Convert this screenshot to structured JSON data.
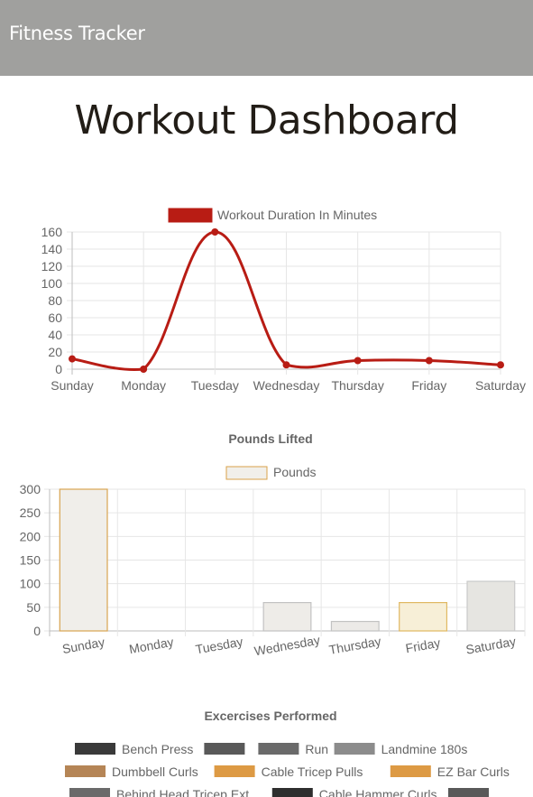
{
  "app": {
    "title": "Fitness Tracker"
  },
  "page": {
    "title": "Workout Dashboard"
  },
  "colors": {
    "header_bg": "#a0a09e",
    "duration_line": "#b81c14",
    "pounds_border": "#d9a24a"
  },
  "charts": {
    "duration": {
      "legend": "Workout Duration In Minutes",
      "y_ticks": [
        "0",
        "20",
        "40",
        "60",
        "80",
        "100",
        "120",
        "140",
        "160"
      ],
      "x_ticks": [
        "Sunday",
        "Monday",
        "Tuesday",
        "Wednesday",
        "Thursday",
        "Friday",
        "Saturday"
      ]
    },
    "pounds": {
      "title": "Pounds Lifted",
      "legend": "Pounds",
      "y_ticks": [
        "0",
        "50",
        "100",
        "150",
        "200",
        "250",
        "300"
      ],
      "x_ticks": [
        "Sunday",
        "Monday",
        "Tuesday",
        "Wednesday",
        "Thursday",
        "Friday",
        "Saturday"
      ]
    },
    "exercises": {
      "title": "Excercises Performed",
      "legend": [
        {
          "label": "Bench Press",
          "color": "#3a3a3a"
        },
        {
          "label": "",
          "color": "#595959"
        },
        {
          "label": "Run",
          "color": "#6a6a6a"
        },
        {
          "label": "Landmine 180s",
          "color": "#8c8c8c"
        },
        {
          "label": "Dumbbell Curls",
          "color": "#b58556"
        },
        {
          "label": "Cable Tricep Pulls",
          "color": "#dd9a44"
        },
        {
          "label": "EZ Bar Curls",
          "color": "#dd9a44"
        },
        {
          "label": "Behind Head Tricep Ext",
          "color": "#6a6a6a"
        },
        {
          "label": "Cable Hammer Curls",
          "color": "#2e2e2e"
        },
        {
          "label": "",
          "color": "#595959"
        }
      ]
    }
  },
  "chart_data": [
    {
      "type": "line",
      "categories": [
        "Sunday",
        "Monday",
        "Tuesday",
        "Wednesday",
        "Thursday",
        "Friday",
        "Saturday"
      ],
      "series": [
        {
          "name": "Workout Duration In Minutes",
          "values": [
            12,
            0,
            160,
            5,
            10,
            10,
            5
          ]
        }
      ],
      "ylim": [
        0,
        160
      ],
      "grid": true,
      "legend": "top"
    },
    {
      "type": "bar",
      "title": "Pounds Lifted",
      "categories": [
        "Sunday",
        "Monday",
        "Tuesday",
        "Wednesday",
        "Thursday",
        "Friday",
        "Saturday"
      ],
      "series": [
        {
          "name": "Pounds",
          "values": [
            300,
            0,
            0,
            60,
            20,
            60,
            105
          ]
        }
      ],
      "ylim": [
        0,
        300
      ],
      "grid": true,
      "legend": "top"
    }
  ]
}
